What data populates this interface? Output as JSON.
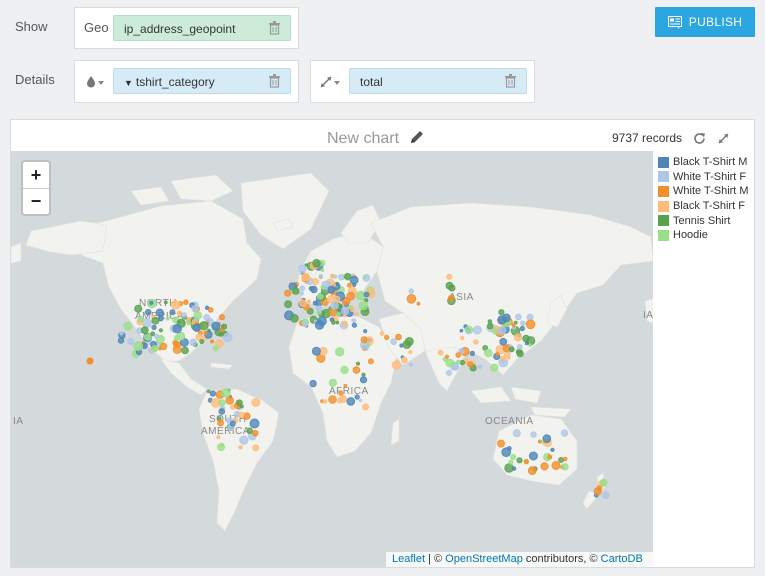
{
  "show": {
    "label": "Show",
    "geo_prefix": "Geo",
    "geo_field": "ip_address_geopoint"
  },
  "details": {
    "label": "Details",
    "color_field": "tshirt_category",
    "size_field": "total"
  },
  "publish": {
    "label": "PUBLISH"
  },
  "chart": {
    "title": "New chart",
    "records": "9737 records"
  },
  "map": {
    "zoom_in": "+",
    "zoom_out": "−",
    "labels": [
      "NORTH",
      "AMERICA",
      "ASIA",
      "AFRICA",
      "SOUTH",
      "AMERICA",
      "OCEANIA",
      "IA",
      "IA"
    ],
    "attribution": {
      "leaflet": "Leaflet",
      "sep1": " | © ",
      "osm": "OpenStreetMap",
      "mid": " contributors, © ",
      "carto": "CartoDB"
    }
  },
  "legend": [
    {
      "label": "Black T-Shirt M",
      "color": "#4e86b8"
    },
    {
      "label": "White T-Shirt F",
      "color": "#aec7e8"
    },
    {
      "label": "White T-Shirt M",
      "color": "#f28e2b"
    },
    {
      "label": "Black T-Shirt F",
      "color": "#ffbb78"
    },
    {
      "label": "Tennis Shirt",
      "color": "#59a14f"
    },
    {
      "label": "Hoodie",
      "color": "#98df8a"
    }
  ]
}
